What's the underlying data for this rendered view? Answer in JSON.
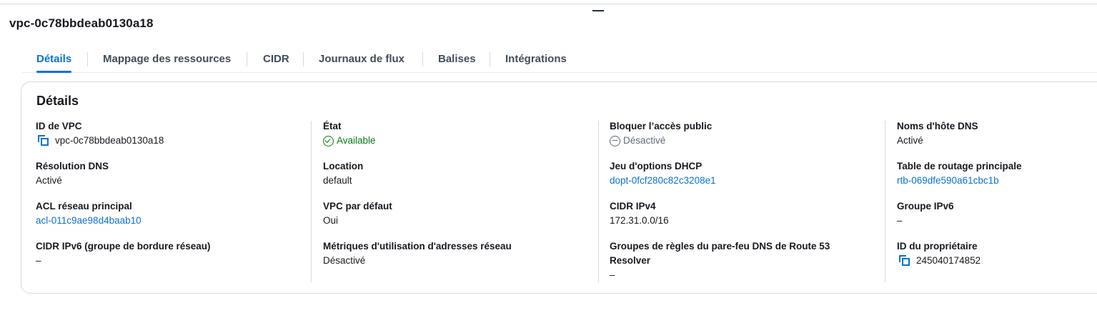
{
  "vpc_id_title": "vpc-0c78bbdeab0130a18",
  "tabs": [
    {
      "label": "Détails"
    },
    {
      "label": "Mappage des ressources"
    },
    {
      "label": "CIDR"
    },
    {
      "label": "Journaux de flux"
    },
    {
      "label": "Balises"
    },
    {
      "label": "Intégrations"
    }
  ],
  "panel_title": "Détails",
  "details": {
    "vpc_id": {
      "key": "ID de VPC",
      "value": "vpc-0c78bbdeab0130a18"
    },
    "dns_resolution": {
      "key": "Résolution DNS",
      "value": "Activé"
    },
    "main_acl": {
      "key": "ACL réseau principal",
      "value": "acl-011c9ae98d4baab10"
    },
    "ipv6_cidr_border": {
      "key": "CIDR IPv6 (groupe de bordure réseau)",
      "value": "–"
    },
    "state": {
      "key": "État",
      "value": "Available"
    },
    "location": {
      "key": "Location",
      "value": "default"
    },
    "default_vpc": {
      "key": "VPC par défaut",
      "value": "Oui"
    },
    "network_metrics": {
      "key": "Métriques d'utilisation d'adresses réseau",
      "value": "Désactivé"
    },
    "block_public_access": {
      "key": "Bloquer l’accès public",
      "value": "Désactivé"
    },
    "dhcp_options": {
      "key": "Jeu d'options DHCP",
      "value": "dopt-0fcf280c82c3208e1"
    },
    "ipv4_cidr": {
      "key": "CIDR IPv4",
      "value": "172.31.0.0/16"
    },
    "route53_firewall": {
      "key_line1": "Groupes de règles du pare-feu DNS de Route 53",
      "key_line2": "Resolver",
      "value": "–"
    },
    "dns_hostnames": {
      "key": "Noms d'hôte DNS",
      "value": "Activé"
    },
    "main_route_table": {
      "key": "Table de routage principale",
      "value": "rtb-069dfe590a61cbc1b"
    },
    "ipv6_group": {
      "key": "Groupe IPv6",
      "value": "–"
    },
    "owner_id": {
      "key": "ID du propriétaire",
      "value": "245040174852"
    }
  },
  "colors": {
    "link": "#0972d3",
    "success": "#037f0c",
    "muted": "#5f6b7a",
    "text": "#16191f"
  }
}
